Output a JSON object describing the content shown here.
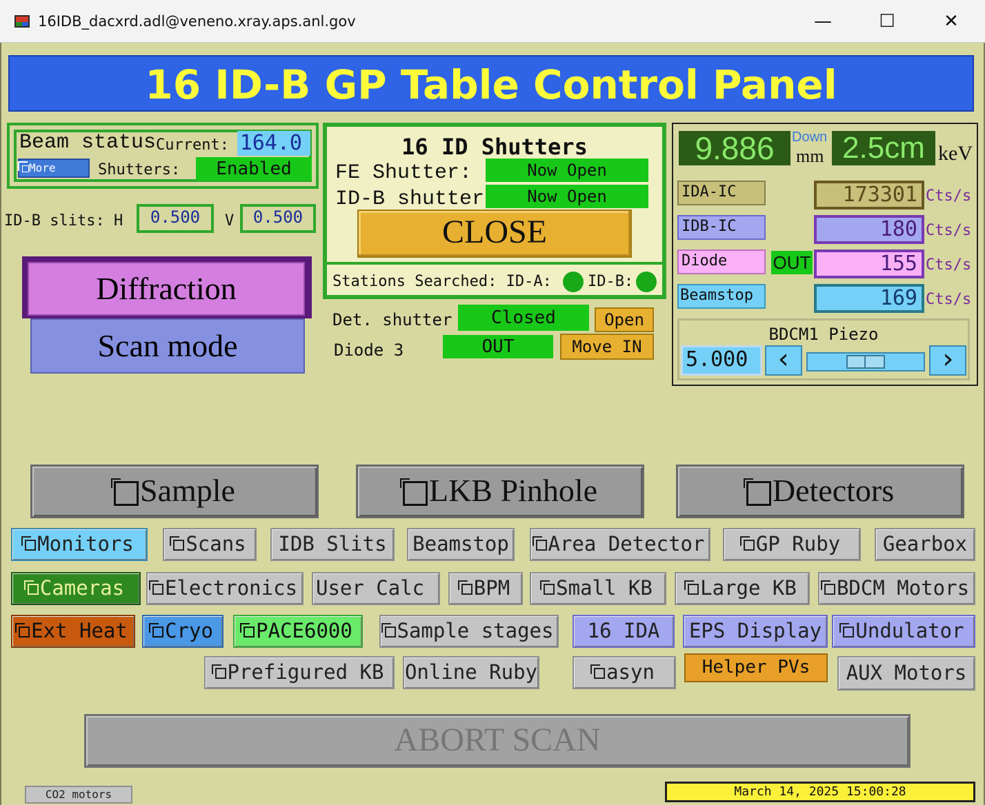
{
  "window": {
    "title": "16IDB_dacxrd.adl@veneno.xray.aps.anl.gov",
    "minimize_glyph": "—",
    "maximize_glyph": "☐",
    "close_glyph": "✕"
  },
  "banner": {
    "title": "16 ID-B GP Table Control Panel"
  },
  "beam": {
    "status_label": "Beam status",
    "current_label": "Current:",
    "current_value": "164.0",
    "more_label": "More",
    "shutters_label": "Shutters:",
    "shutters_value": "Enabled"
  },
  "slits": {
    "label": "ID-B slits: H",
    "h_value": "0.500",
    "v_label": "V",
    "v_value": "0.500"
  },
  "modes": {
    "diffraction": "Diffraction",
    "scan": "Scan mode"
  },
  "shutters": {
    "title": "16 ID Shutters",
    "fe_label": "FE Shutter:",
    "fe_value": "Now Open",
    "idb_label": "ID-B shutter:",
    "idb_value": "Now Open",
    "close_label": "CLOSE",
    "searched_label": "Stations Searched: ID-A:",
    "idb_search_label": "ID-B:"
  },
  "det_shutter": {
    "label": "Det. shutter",
    "value": "Closed",
    "open_label": "Open",
    "diode_label": "Diode 3",
    "diode_value": "OUT",
    "move_in_label": "Move IN"
  },
  "readouts": {
    "energy_value": "9.886",
    "down_label": "Down",
    "mm_label": "mm",
    "down_value": "2.5cm",
    "kev_label": "keV"
  },
  "detectors_rows": [
    {
      "label": "IDA-IC",
      "value": "173301",
      "unit": "Cts/s"
    },
    {
      "label": "IDB-IC",
      "value": "180",
      "unit": "Cts/s"
    },
    {
      "label": "Diode",
      "value": "155",
      "unit": "Cts/s",
      "state": "OUT"
    },
    {
      "label": "Beamstop",
      "value": "169",
      "unit": "Cts/s"
    }
  ],
  "piezo": {
    "title": "BDCM1 Piezo",
    "value": "5.000",
    "left_glyph": "‹",
    "right_glyph": "›",
    "slider_fraction": 0.5
  },
  "big_buttons": {
    "sample": "Sample",
    "lkb": "LKB Pinhole",
    "detectors": "Detectors"
  },
  "row1": [
    "Monitors",
    "Scans",
    "IDB Slits",
    "Beamstop",
    "Area Detector",
    "GP Ruby",
    "Gearbox"
  ],
  "row2": [
    "Cameras",
    "Electronics",
    "User Calc",
    "BPM",
    "Small KB",
    "Large KB",
    "BDCM Motors"
  ],
  "row3": [
    "Ext Heat",
    "Cryo",
    "PACE6000",
    "Sample stages",
    "16 IDA",
    "EPS Display",
    "Undulator"
  ],
  "row4": [
    "Prefigured KB",
    "Online Ruby",
    "asyn",
    "Helper PVs",
    "AUX Motors"
  ],
  "abort": "ABORT SCAN",
  "co2": "CO2 motors",
  "timestamp": "March 14, 2025 15:00:28",
  "colors": {
    "background": "#d6d8a0",
    "banner": "#2f64e6",
    "banner_text": "#fbfb3a",
    "status_green": "#18c818",
    "close_orange": "#e8b030"
  }
}
